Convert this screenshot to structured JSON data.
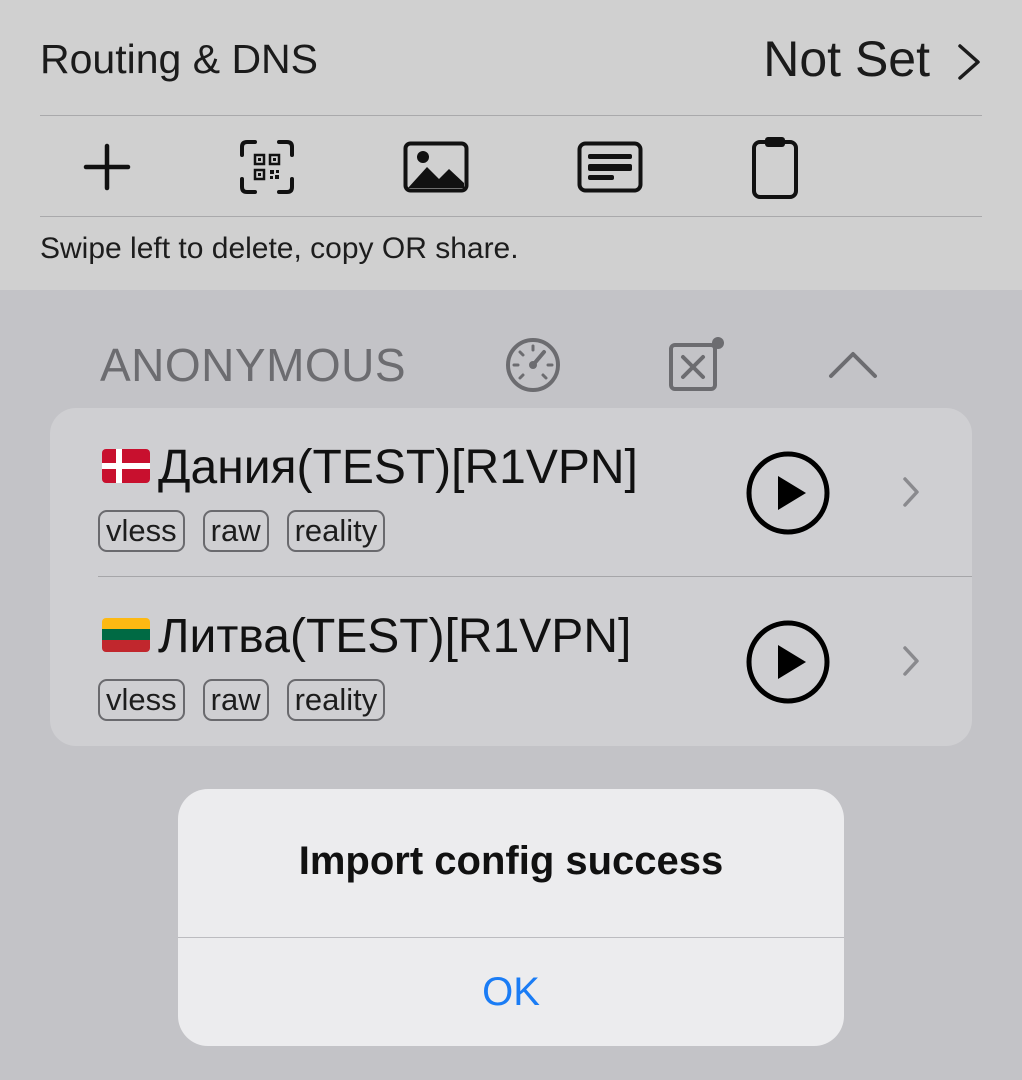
{
  "routing": {
    "label": "Routing & DNS",
    "value": "Not Set"
  },
  "toolbar": {
    "items": [
      {
        "icon": "plus-icon"
      },
      {
        "icon": "qr-scan-icon"
      },
      {
        "icon": "photo-icon"
      },
      {
        "icon": "text-input-icon"
      },
      {
        "icon": "clipboard-icon"
      }
    ]
  },
  "hint": "Swipe left to delete, copy OR share.",
  "group": {
    "title": "ANONYMOUS",
    "icons": [
      "speedometer-icon",
      "clear-icon",
      "chevron-up-icon"
    ]
  },
  "servers": [
    {
      "flag": "denmark-flag",
      "name": "Дания(TEST)[R1VPN]",
      "tags": [
        "vless",
        "raw",
        "reality"
      ]
    },
    {
      "flag": "lithuania-flag",
      "name": "Литва(TEST)[R1VPN]",
      "tags": [
        "vless",
        "raw",
        "reality"
      ]
    }
  ],
  "alert": {
    "title": "Import config success",
    "button": "OK"
  },
  "colors": {
    "accent": "#1a7cf5",
    "background": "#c3c3c7",
    "card": "#cfcfd2"
  }
}
